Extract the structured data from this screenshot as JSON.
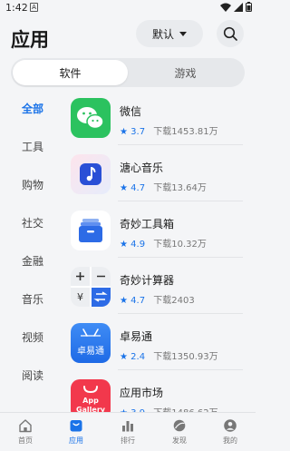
{
  "status": {
    "time": "1:42",
    "notif_letter": "A"
  },
  "header": {
    "title": "应用",
    "sort_label": "默认"
  },
  "tabs": [
    {
      "label": "软件",
      "active": true
    },
    {
      "label": "游戏",
      "active": false
    }
  ],
  "categories": [
    {
      "label": "全部",
      "active": true
    },
    {
      "label": "工具"
    },
    {
      "label": "购物"
    },
    {
      "label": "社交"
    },
    {
      "label": "金融"
    },
    {
      "label": "音乐"
    },
    {
      "label": "视频"
    },
    {
      "label": "阅读"
    }
  ],
  "apps": [
    {
      "name": "微信",
      "rating": "3.7",
      "downloads": "下载1453.81万",
      "icon": "wechat-icon"
    },
    {
      "name": "溏心音乐",
      "rating": "4.7",
      "downloads": "下载13.64万",
      "icon": "music-note-icon"
    },
    {
      "name": "奇妙工具箱",
      "rating": "4.9",
      "downloads": "下载10.32万",
      "icon": "toolbox-icon"
    },
    {
      "name": "奇妙计算器",
      "rating": "4.7",
      "downloads": "下载2403",
      "icon": "calculator-icon"
    },
    {
      "name": "卓易通",
      "rating": "2.4",
      "downloads": "下载1350.93万",
      "icon": "zhuoyitong-icon",
      "icon_text": "卓易通"
    },
    {
      "name": "应用市场",
      "rating": "3.9",
      "downloads": "下载1486.62万",
      "icon": "app-gallery-icon",
      "icon_text_1": "App",
      "icon_text_2": "Gallery"
    }
  ],
  "bottom_nav": [
    {
      "label": "首页",
      "icon": "home-icon",
      "active": false
    },
    {
      "label": "应用",
      "icon": "apps-icon",
      "active": true
    },
    {
      "label": "排行",
      "icon": "ranking-icon",
      "active": false
    },
    {
      "label": "发现",
      "icon": "discover-icon",
      "active": false
    },
    {
      "label": "我的",
      "icon": "profile-icon",
      "active": false
    }
  ],
  "colors": {
    "accent": "#1a73e8",
    "background": "#f4f5f7"
  }
}
